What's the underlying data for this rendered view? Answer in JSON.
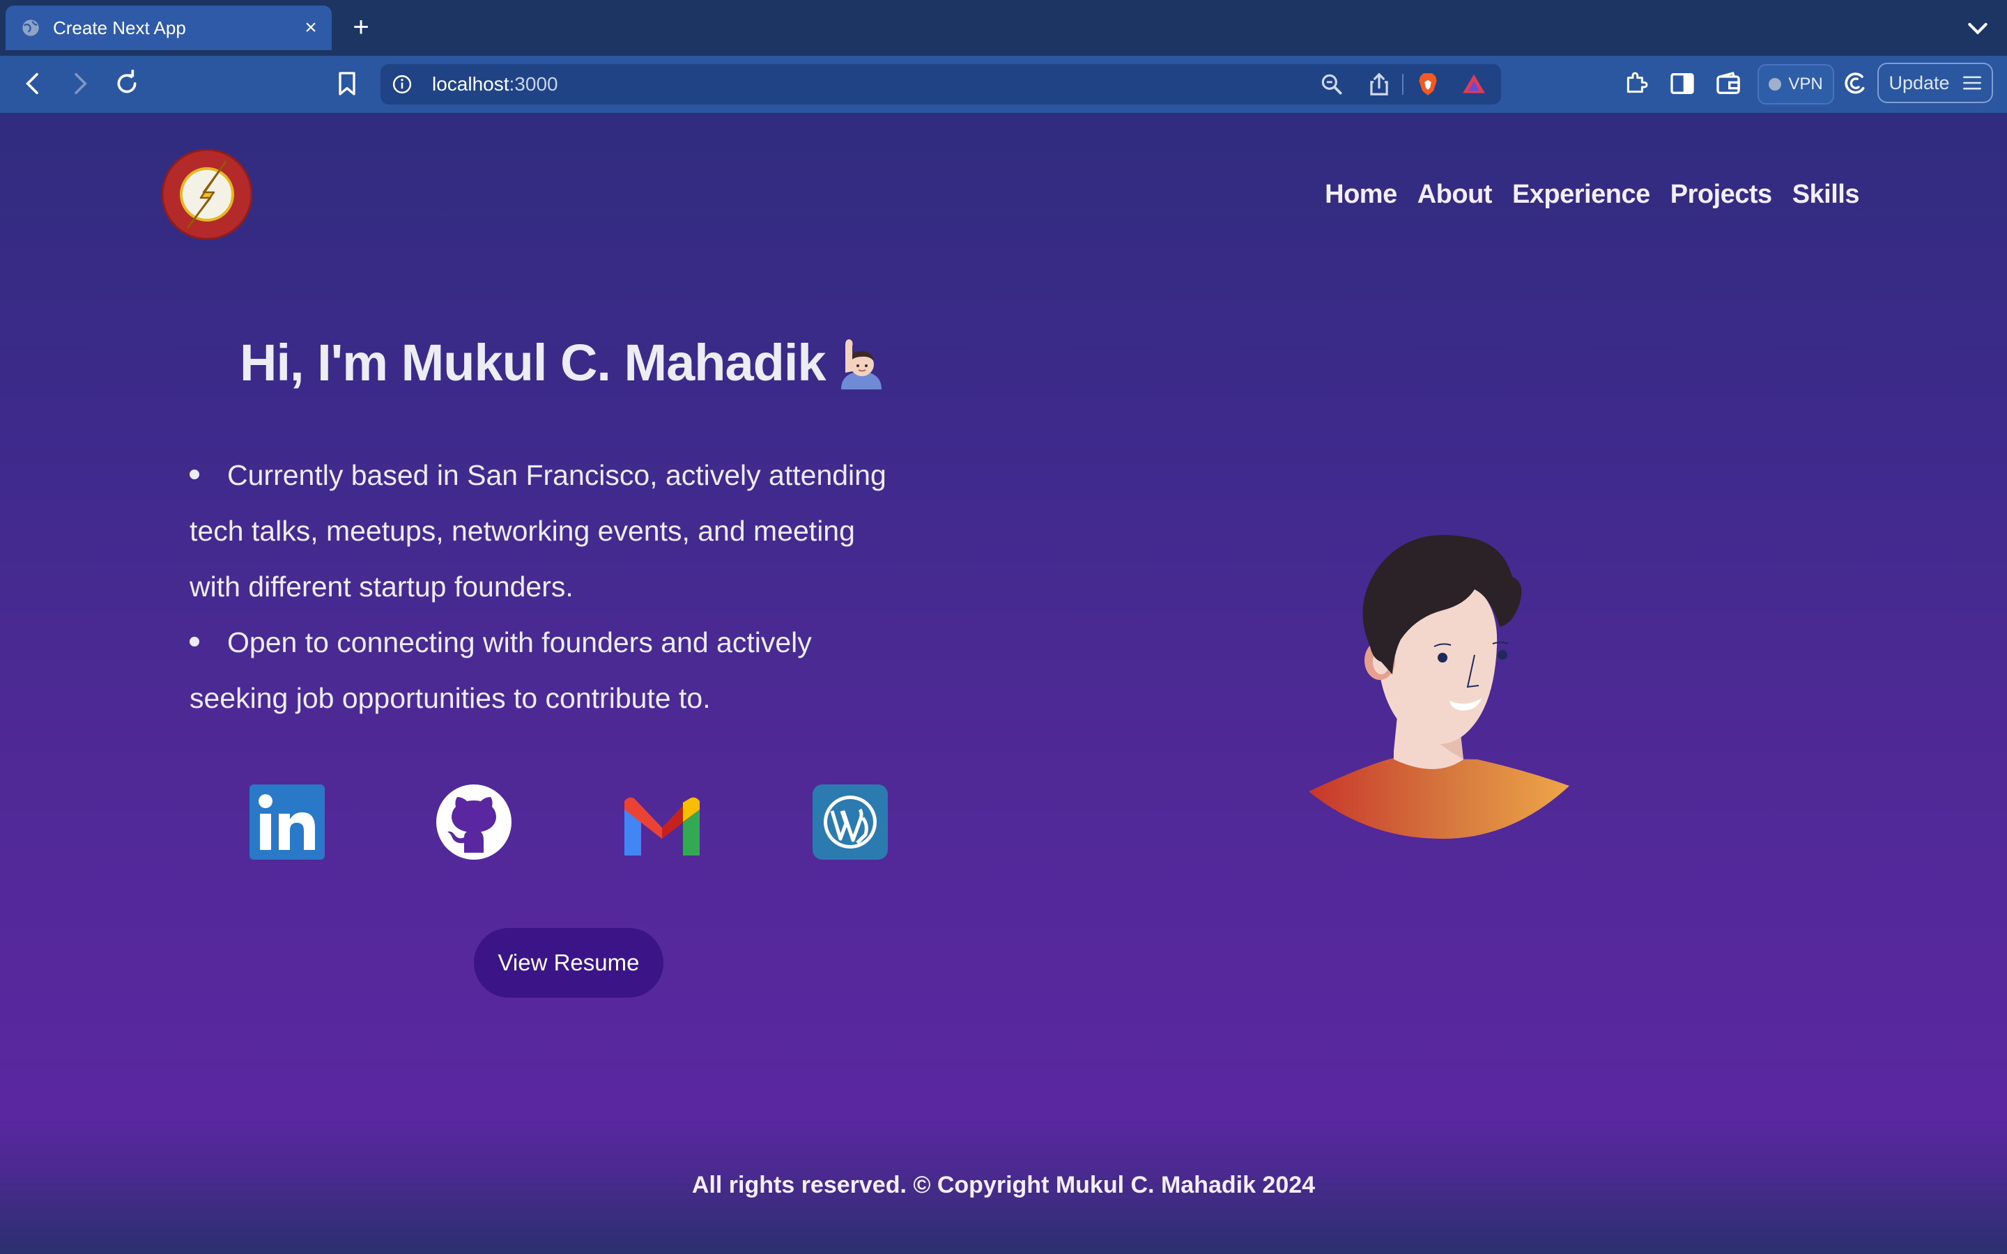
{
  "browser": {
    "tab_title": "Create Next App",
    "tab_close": "×",
    "new_tab": "+",
    "url_host": "localhost",
    "url_port": ":3000",
    "vpn_label": "VPN",
    "update_label": "Update"
  },
  "nav": {
    "links": [
      "Home",
      "About",
      "Experience",
      "Projects",
      "Skills"
    ]
  },
  "hero": {
    "greeting": "Hi, I'm Mukul C. Mahadik",
    "bullet_1_line_1": "Currently based in San Francisco, actively attending",
    "bullet_1_line_2": "tech talks, meetups, networking events, and meeting",
    "bullet_1_line_3": "with different startup founders.",
    "bullet_2_line_1": "Open to connecting with founders and actively",
    "bullet_2_line_2": "seeking job opportunities to contribute to.",
    "resume_button": "View Resume",
    "social_icons": [
      "linkedin-icon",
      "github-icon",
      "gmail-icon",
      "wordpress-icon"
    ]
  },
  "footer": {
    "text": "All rights reserved. © Copyright Mukul C. Mahadik 2024"
  },
  "colors": {
    "accent": "#3b1488",
    "tab_active": "#2f5aa8",
    "toolbar": "#2a579f"
  }
}
